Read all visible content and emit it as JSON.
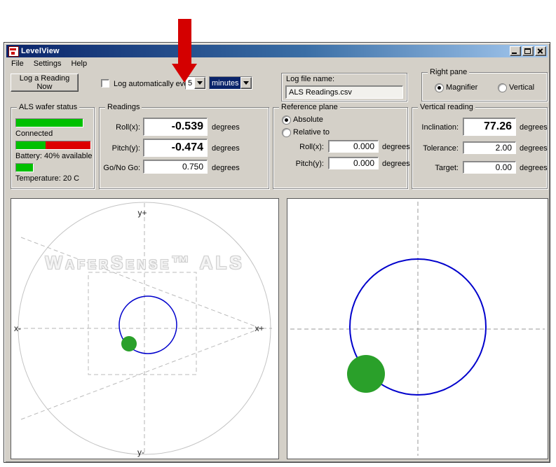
{
  "window": {
    "title": "LevelView"
  },
  "menu": {
    "items": [
      "File",
      "Settings",
      "Help"
    ]
  },
  "toolbar": {
    "log_button_label": "Log a Reading Now",
    "auto_label": "Log automatically every",
    "interval_value": "5",
    "interval_unit": "minutes",
    "logfile_label": "Log file name:",
    "logfile_value": "ALS Readings.csv"
  },
  "right_pane": {
    "title": "Right pane",
    "magnifier": "Magnifier",
    "vertical": "Vertical"
  },
  "status": {
    "title": "ALS wafer status",
    "connected": "Connected",
    "battery": "Battery: 40% available",
    "battery_percent": 40,
    "temperature": "Temperature: 20 C"
  },
  "readings": {
    "title": "Readings",
    "roll": {
      "label": "Roll(x):",
      "value": "-0.539",
      "unit": "degrees"
    },
    "pitch": {
      "label": "Pitch(y):",
      "value": "-0.474",
      "unit": "degrees"
    },
    "gonogo": {
      "label": "Go/No Go:",
      "value": "0.750",
      "unit": "degrees"
    }
  },
  "reference": {
    "title": "Reference plane",
    "absolute": "Absolute",
    "relative": "Relative to",
    "roll": {
      "label": "Roll(x):",
      "value": "0.000",
      "unit": "degrees"
    },
    "pitch": {
      "label": "Pitch(y):",
      "value": "0.000",
      "unit": "degrees"
    }
  },
  "vertical_reading": {
    "title": "Vertical reading",
    "inclination": {
      "label": "Inclination:",
      "value": "77.26",
      "unit": "degrees"
    },
    "tolerance": {
      "label": "Tolerance:",
      "value": "2.00",
      "unit": "degrees"
    },
    "target": {
      "label": "Target:",
      "value": "0.00",
      "unit": "degrees"
    }
  },
  "left_panel": {
    "watermark": "WaferSense™ ALS",
    "axis_top": "y+",
    "axis_bottom": "y-",
    "axis_left": "x-",
    "axis_right": "x+"
  },
  "colors": {
    "circle_blue": "#0000cc",
    "indicator_green": "#2aa02a",
    "bar_green": "#00c000",
    "bar_red": "#dd0000",
    "arrow_red": "#d40000",
    "selection_blue": "#0a246a"
  }
}
